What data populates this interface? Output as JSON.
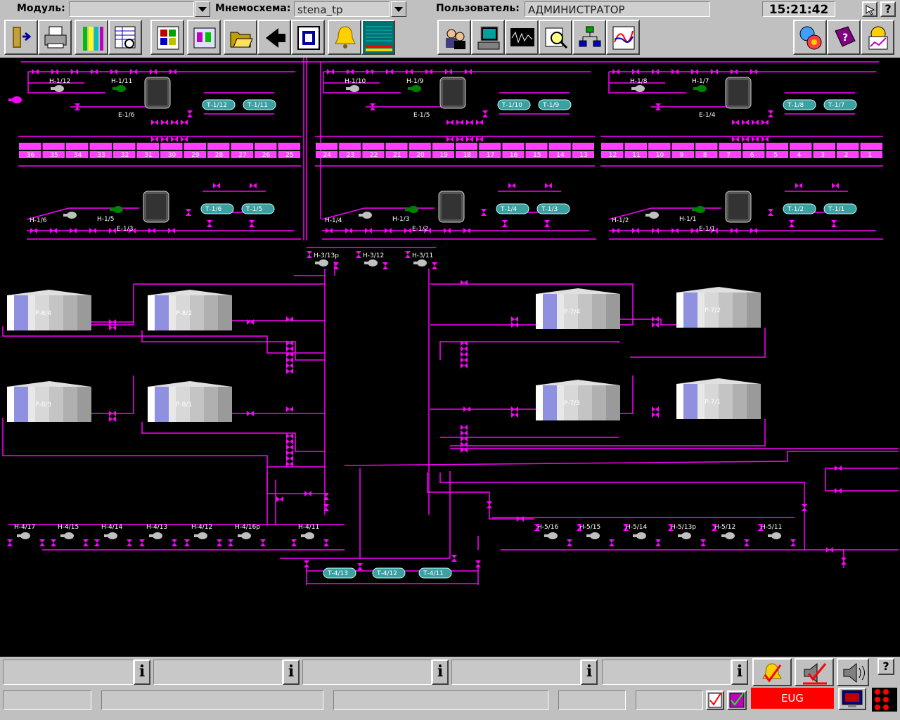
{
  "header": {
    "module_label": "Модуль:",
    "module_value": "",
    "scheme_label": "Мнемосхема:",
    "scheme_value": "stena_tp",
    "user_label": "Пользователь:",
    "user_value": "АДМИНИСТРАТОР",
    "clock": "15:21:42",
    "help_symbol": "?"
  },
  "toolbar": {
    "left_icons": [
      "exit-icon",
      "printer-icon",
      "bar-chart-icon",
      "table-search-icon",
      "windows-icon",
      "mnemo-panel-icon",
      "folder-open-icon",
      "back-arrow-icon",
      "frame-icon",
      "bell-icon",
      "event-grid-icon"
    ],
    "right_icons": [
      "users-icon",
      "operator-terminal-icon",
      "trend-wave-icon",
      "magnifier-chart-icon",
      "network-diagram-icon",
      "trend-report-icon"
    ],
    "far_right_icons": [
      "settings-clock-icon",
      "help-book-icon",
      "graph-window-icon"
    ]
  },
  "scheme": {
    "block_top_left": {
      "heaters": [
        "Н-1/12",
        "Н-1/11"
      ],
      "tank": "Е-1/6",
      "tanks_small": [
        "Т-1/12",
        "Т-1/11"
      ]
    },
    "block_top_mid": {
      "heaters": [
        "Н-1/10",
        "Н-1/9"
      ],
      "tank": "Е-1/5",
      "tanks_small": [
        "Т-1/10",
        "Т-1/9"
      ]
    },
    "block_top_right": {
      "heaters": [
        "Н-1/8",
        "Н-1/7"
      ],
      "tank": "Е-1/4",
      "tanks_small": [
        "Т-1/8",
        "Т-1/7"
      ]
    },
    "block_bot_left": {
      "heaters": [
        "Н-1/6",
        "Н-1/5"
      ],
      "tank": "Е-1/3",
      "tanks_small": [
        "Т-1/6",
        "Т-1/5"
      ]
    },
    "block_bot_mid": {
      "heaters": [
        "Н-1/4",
        "Н-1/3"
      ],
      "tank": "Е-1/2",
      "tanks_small": [
        "Т-1/4",
        "Т-1/3"
      ]
    },
    "block_bot_right": {
      "heaters": [
        "Н-1/2",
        "Н-1/1"
      ],
      "tank": "Е-1/1",
      "tanks_small": [
        "Т-1/2",
        "Т-1/1"
      ]
    },
    "manifold_numbers": [
      "36",
      "35",
      "34",
      "33",
      "32",
      "31",
      "30",
      "29",
      "28",
      "27",
      "26",
      "25",
      "24",
      "23",
      "22",
      "21",
      "20",
      "19",
      "18",
      "17",
      "16",
      "15",
      "14",
      "13",
      "12",
      "11",
      "10",
      "9",
      "8",
      "7",
      "6",
      "5",
      "4",
      "3",
      "2",
      "1"
    ],
    "pumps_mid": [
      "Н-3/13р",
      "Н-3/12",
      "Н-3/11"
    ],
    "reservoirs_left": [
      "Р-8/4",
      "Р-8/2",
      "Р-8/3",
      "Р-8/1"
    ],
    "reservoirs_right": [
      "Р-7/4",
      "Р-7/2",
      "Р-7/3",
      "Р-7/1"
    ],
    "pumps_4": [
      "Н-4/17",
      "Н-4/15",
      "Н-4/14",
      "Н-4/13",
      "Н-4/12",
      "Н-4/16р",
      "Н-4/11"
    ],
    "pumps_5": [
      "Н-5/16",
      "Н-5/15",
      "Н-5/14",
      "Н-5/13р",
      "Н-5/12",
      "Н-5/11"
    ],
    "tanks_4": [
      "Т-4/13",
      "Т-4/12",
      "Т-4/11"
    ]
  },
  "statusbar": {
    "info_symbol": "i",
    "eug_label": "EUG",
    "eug_color": "#ff0000",
    "pipe_color": "#ff00ff"
  }
}
